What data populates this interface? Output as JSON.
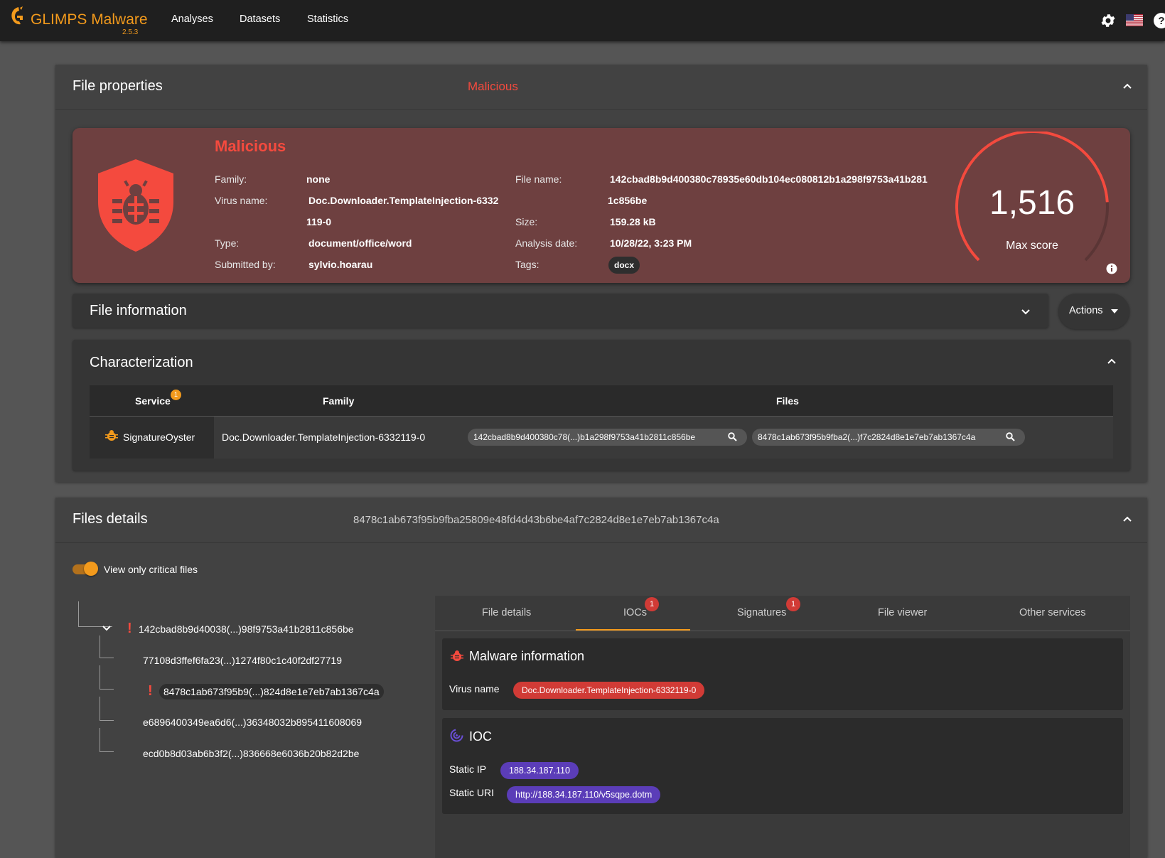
{
  "app": {
    "brand": "GLIMPS Malware",
    "version": "2.5.3",
    "nav": [
      "Analyses",
      "Datasets",
      "Statistics"
    ]
  },
  "colors": {
    "accent": "#f39a1c",
    "malicious": "#f44a3e",
    "malicious_card": "#6e4040",
    "ioc_chip": "#5b3db8"
  },
  "icons": {
    "settings": "gear-icon",
    "language": "us-flag-icon",
    "help": "help-icon",
    "verdict": "shield-bug-icon",
    "service": "bug-icon",
    "search": "search-icon",
    "ioc": "ioc-target-icon"
  },
  "file_properties": {
    "title": "File properties",
    "verdict": "Malicious",
    "card": {
      "verdict": "Malicious",
      "family_label": "Family:",
      "family": "none",
      "virus_name_label": "Virus name:",
      "virus_name_line1": "Doc.Downloader.TemplateInjection-6332",
      "virus_name_line2": "119-0",
      "type_label": "Type:",
      "type": "document/office/word",
      "submitted_by_label": "Submitted by:",
      "submitted_by": "sylvio.hoarau",
      "file_name_label": "File name:",
      "file_name_line1": "142cbad8b9d400380c78935e60db104ec080812b1a298f9753a41b281",
      "file_name_line2": "1c856be",
      "size_label": "Size:",
      "size": "159.28 kB",
      "analysis_date_label": "Analysis date:",
      "analysis_date": "10/28/22, 3:23 PM",
      "tags_label": "Tags:",
      "tags": [
        "docx"
      ],
      "score": "1,516",
      "score_label": "Max score",
      "score_fraction": 0.82
    }
  },
  "file_information": {
    "title": "File information",
    "actions_label": "Actions"
  },
  "characterization": {
    "title": "Characterization",
    "columns": [
      "Service",
      "Family",
      "Files"
    ],
    "service_badge": "1",
    "rows": [
      {
        "service": "SignatureOyster",
        "family": "Doc.Downloader.TemplateInjection-6332119-0",
        "files": [
          "142cbad8b9d400380c78(...)b1a298f9753a41b2811c856be",
          "8478c1ab673f95b9fba2(...)f7c2824d8e1e7eb7ab1367c4a"
        ]
      }
    ]
  },
  "files_details": {
    "title": "Files details",
    "selected_hash": "8478c1ab673f95b9fba25809e48fd4d43b6be4af7c2824d8e1e7eb7ab1367c4a",
    "toggle_label": "View only critical files",
    "toggle_on": true,
    "tree": [
      "142cbad8b9d40038(...)98f9753a41b2811c856be",
      "77108d3ffef6fa23(...)1274f80c1c40f2df27719",
      "8478c1ab673f95b9(...)824d8e1e7eb7ab1367c4a",
      "e6896400349ea6d6(...)36348032b895411608069",
      "ecd0b8d03ab6b3f2(...)836668e6036b20b82d2be"
    ],
    "tabs": [
      "File details",
      "IOCs",
      "Signatures",
      "File viewer",
      "Other services"
    ],
    "tab_badges": {
      "iocs": "1",
      "signatures": "1"
    },
    "active_tab": "IOCs",
    "malware_info": {
      "title": "Malware information",
      "virus_name_label": "Virus name",
      "virus_name": "Doc.Downloader.TemplateInjection-6332119-0"
    },
    "ioc": {
      "title": "IOC",
      "static_ip_label": "Static IP",
      "static_ip": "188.34.187.110",
      "static_uri_label": "Static URI",
      "static_uri": "http://188.34.187.110/v5sqpe.dotm"
    }
  }
}
